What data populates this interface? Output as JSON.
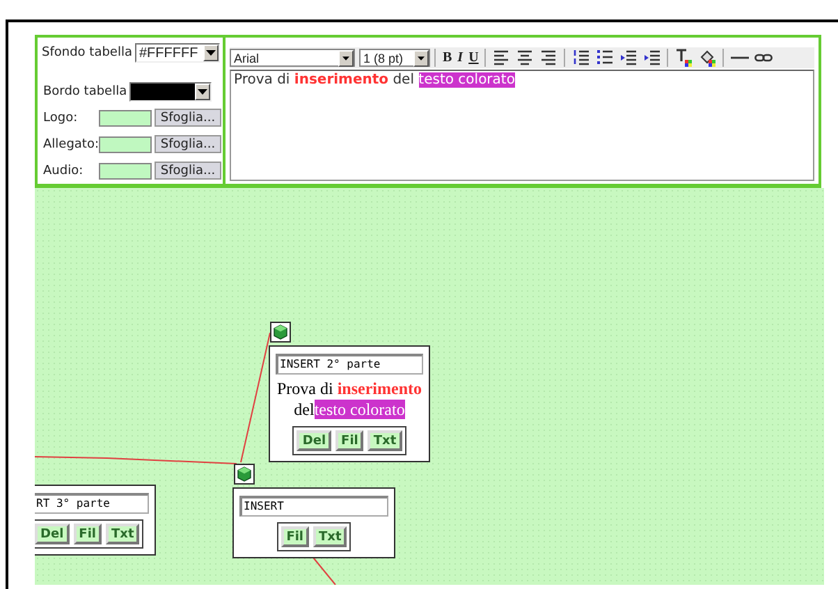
{
  "table_settings": {
    "background": {
      "label": "Sfondo tabella",
      "value": "#FFFFFF"
    },
    "border": {
      "label": "Bordo tabella",
      "color": "#000000"
    },
    "files": [
      {
        "label": "Logo:",
        "button": "Sfoglia..."
      },
      {
        "label": "Allegato:",
        "button": "Sfoglia..."
      },
      {
        "label": "Audio:",
        "button": "Sfoglia..."
      }
    ]
  },
  "editor": {
    "font": "Arial",
    "size": "1 (8 pt)",
    "toolbar_groups": [
      [
        {
          "kind": "bold",
          "label": "B"
        },
        {
          "kind": "italic",
          "label": "I"
        },
        {
          "kind": "underline",
          "label": "U"
        }
      ],
      [
        {
          "kind": "align-left"
        },
        {
          "kind": "align-center"
        },
        {
          "kind": "align-right"
        }
      ],
      [
        {
          "kind": "ordered-list"
        },
        {
          "kind": "bullet-list"
        },
        {
          "kind": "outdent"
        },
        {
          "kind": "indent"
        }
      ],
      [
        {
          "kind": "text-color"
        },
        {
          "kind": "fill-color"
        }
      ],
      [
        {
          "kind": "horizontal-rule"
        },
        {
          "kind": "link"
        }
      ]
    ],
    "content": [
      {
        "text": "Prova di ",
        "kind": "plain"
      },
      {
        "text": "inserimento",
        "kind": "bold",
        "color": "#ff3333"
      },
      {
        "text": " del ",
        "kind": "plain"
      },
      {
        "text": "testo colorato",
        "kind": "highlight",
        "color": "#cc33cc"
      }
    ]
  },
  "canvas": {
    "nodes": [
      {
        "handle": true,
        "title": "INSERT 2° parte",
        "content": [
          {
            "text": "Prova di ",
            "kind": "plain"
          },
          {
            "text": "inserimento",
            "kind": "bold",
            "color": "#ff3333"
          },
          {
            "text": " del",
            "kind": "plain"
          },
          {
            "text": "testo colorato",
            "kind": "highlight",
            "color": "#cc33cc"
          }
        ],
        "buttons": [
          "Del",
          "Fil",
          "Txt"
        ]
      },
      {
        "handle": false,
        "title": "RT 3° parte",
        "buttons": [
          "Del",
          "Fil",
          "Txt"
        ]
      },
      {
        "handle": true,
        "title": "INSERT",
        "buttons": [
          "Fil",
          "Txt"
        ]
      }
    ]
  }
}
